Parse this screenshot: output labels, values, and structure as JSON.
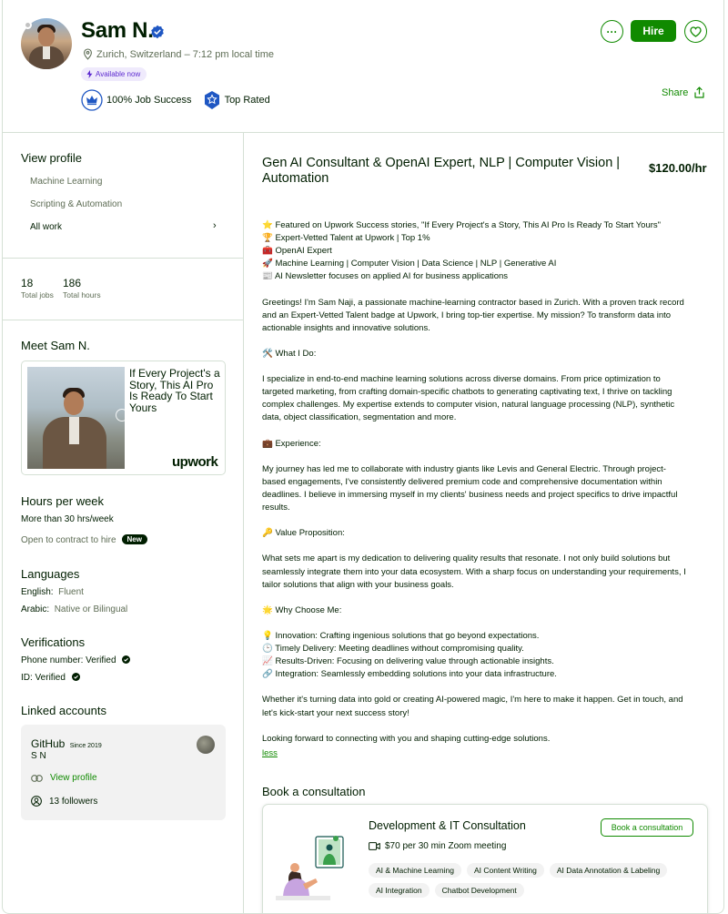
{
  "header": {
    "name": "Sam N.",
    "location": "Zurich, Switzerland – 7:12 pm local time",
    "availability": "Available now",
    "badges": [
      {
        "label": "100% Job Success",
        "icon": "crown-icon"
      },
      {
        "label": "Top Rated",
        "icon": "star-badge-icon"
      }
    ],
    "more_label": "···",
    "hire_label": "Hire",
    "share_label": "Share"
  },
  "sidebar": {
    "view_profile_title": "View profile",
    "profile_items": [
      {
        "label": "Machine Learning"
      },
      {
        "label": "Scripting & Automation"
      },
      {
        "label": "All work"
      }
    ],
    "stats": [
      {
        "value": "18",
        "label": "Total jobs"
      },
      {
        "value": "186",
        "label": "Total hours"
      }
    ],
    "meet_title": "Meet Sam N.",
    "video_caption": "If Every Project's a Story, This AI Pro Is Ready To Start Yours",
    "video_brand": "upwork",
    "hours_title": "Hours per week",
    "hours_value": "More than 30 hrs/week",
    "contract_to_hire": "Open to contract to hire",
    "new_badge": "New",
    "languages_title": "Languages",
    "languages": [
      {
        "name": "English:",
        "level": "Fluent"
      },
      {
        "name": "Arabic:",
        "level": "Native or Bilingual"
      }
    ],
    "verifications_title": "Verifications",
    "verifications": [
      {
        "label": "Phone number: Verified"
      },
      {
        "label": "ID: Verified"
      }
    ],
    "linked_title": "Linked accounts",
    "github": {
      "title": "GitHub",
      "since": "Since 2019",
      "user": "S N",
      "view_profile": "View profile",
      "followers": "13 followers"
    }
  },
  "main": {
    "headline": "Gen AI Consultant & OpenAI Expert, NLP | Computer Vision | Automation",
    "rate": "$120.00/hr",
    "bio_lines": [
      "⭐ Featured on Upwork Success stories, \"If Every Project's a Story, This AI Pro Is Ready To Start Yours\"",
      "🏆 Expert-Vetted Talent at Upwork | Top 1%",
      "🧰 OpenAI Expert",
      "🚀 Machine Learning | Computer Vision | Data Science | NLP | Generative AI",
      "📰 AI Newsletter focuses on applied AI for business applications",
      "",
      "Greetings! I'm Sam Naji, a passionate machine-learning contractor based in Zurich. With a proven track record",
      "and an Expert-Vetted Talent badge at Upwork, I bring top-tier expertise. My mission? To transform data into",
      "actionable insights and innovative solutions.",
      "",
      "🛠️ What I Do:",
      "",
      "I specialize in end-to-end machine learning solutions across diverse domains. From price optimization to",
      "targeted marketing, from crafting domain-specific chatbots to generating captivating text, I thrive on tackling",
      "complex challenges. My expertise extends to computer vision, natural language processing (NLP), synthetic",
      "data, object classification, segmentation and more.",
      "",
      "💼 Experience:",
      "",
      "My journey has led me to collaborate with industry giants like Levis and General Electric. Through project-",
      "based engagements, I've consistently delivered premium code and comprehensive documentation within",
      "deadlines. I believe in immersing myself in my clients' business needs and project specifics to drive impactful",
      "results.",
      "",
      "🔑 Value Proposition:",
      "",
      "What sets me apart is my dedication to delivering quality results that resonate. I not only build solutions but",
      "seamlessly integrate them into your data ecosystem. With a sharp focus on understanding your requirements, I",
      "tailor solutions that align with your business goals.",
      "",
      "🌟 Why Choose Me:",
      "",
      "💡 Innovation: Crafting ingenious solutions that go beyond expectations.",
      "🕒 Timely Delivery: Meeting deadlines without compromising quality.",
      "📈 Results-Driven: Focusing on delivering value through actionable insights.",
      "🔗 Integration: Seamlessly embedding solutions into your data infrastructure.",
      "",
      "Whether it's turning data into gold or creating AI-powered magic, I'm here to make it happen. Get in touch, and",
      "let's kick-start your next success story!",
      "",
      "Looking forward to connecting with you and shaping cutting-edge solutions."
    ],
    "less_label": "less",
    "consultation": {
      "section_title": "Book a consultation",
      "name": "Development & IT Consultation",
      "price": "$70 per 30 min Zoom meeting",
      "book_label": "Book a consultation",
      "tags": [
        "AI & Machine Learning",
        "AI Content Writing",
        "AI Data Annotation & Labeling",
        "AI Integration",
        "Chatbot Development"
      ]
    }
  },
  "colors": {
    "brand_green": "#108a00",
    "text": "#001e00",
    "muted": "#5e6d55",
    "available_purple": "#5d2bd0",
    "verified_blue": "#1f57c3"
  }
}
